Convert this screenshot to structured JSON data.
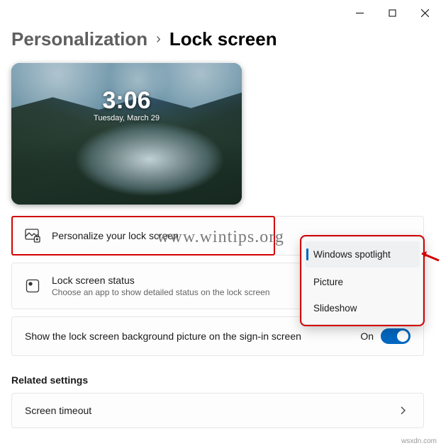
{
  "titlebar": {
    "minimize": "Minimize",
    "maximize": "Maximize",
    "close": "Close"
  },
  "breadcrumb": {
    "parent": "Personalization",
    "current": "Lock screen"
  },
  "preview": {
    "time": "3:06",
    "date": "Tuesday, March 29"
  },
  "watermark": "www.wintips.org",
  "source_mark": "wsxdn.com",
  "settings": {
    "personalize": {
      "title": "Personalize your lock screen"
    },
    "status": {
      "title": "Lock screen status",
      "sub": "Choose an app to show detailed status on the lock screen"
    },
    "signin_bg": {
      "title": "Show the lock screen background picture on the sign-in screen",
      "state": "On"
    }
  },
  "dropdown": {
    "options": [
      "Windows spotlight",
      "Picture",
      "Slideshow"
    ],
    "selected": "Windows spotlight"
  },
  "related": {
    "heading": "Related settings",
    "timeout": "Screen timeout"
  }
}
